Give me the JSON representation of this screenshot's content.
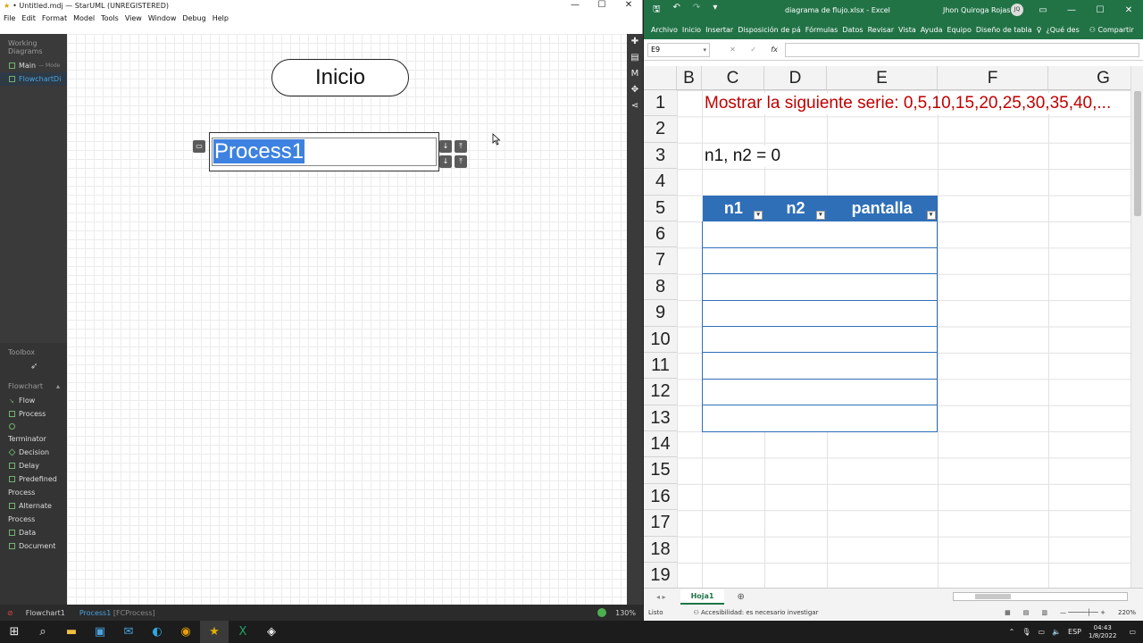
{
  "staruml": {
    "title": "• Untitled.mdj — StarUML (UNREGISTERED)",
    "menu": [
      "File",
      "Edit",
      "Format",
      "Model",
      "Tools",
      "View",
      "Window",
      "Debug",
      "Help"
    ],
    "working_diagrams_label": "Working Diagrams",
    "diagrams": [
      {
        "label": "Main",
        "sub": "— Mode"
      },
      {
        "label": "FlowchartDi",
        "sub": ""
      }
    ],
    "toolbox_label": "Toolbox",
    "flowchart_label": "Flowchart",
    "tools": [
      "Flow",
      "Process",
      "",
      "Terminator",
      "Decision",
      "Delay",
      "Predefined",
      "Process",
      "Alternate",
      "Process",
      "Data",
      "Document"
    ],
    "canvas": {
      "terminator_text": "Inicio",
      "process_text": "Process1"
    },
    "status": {
      "tab": "Flowchart1",
      "crumb": "Process1",
      "crumb_type": "[FCProcess]",
      "zoom": "130%"
    }
  },
  "excel": {
    "file_name": "diagrama de flujo.xlsx  -  Excel",
    "user": "Jhon Quiroga Rojas",
    "user_initials": "JQ",
    "ribbon_tabs": [
      "Archivo",
      "Inicio",
      "Insertar",
      "Disposición de pá",
      "Fórmulas",
      "Datos",
      "Revisar",
      "Vista",
      "Ayuda",
      "Equipo",
      "Diseño de tabla",
      "¿Qué des"
    ],
    "share_label": "Compartir",
    "name_box": "E9",
    "formula_value": "",
    "columns": [
      "B",
      "C",
      "D",
      "E",
      "F",
      "G"
    ],
    "rows": [
      "1",
      "2",
      "3",
      "4",
      "5",
      "6",
      "7",
      "8",
      "9",
      "10",
      "11",
      "12",
      "13",
      "14",
      "15",
      "16",
      "17",
      "18",
      "19"
    ],
    "cell_C1": "Mostrar la siguiente serie: 0,5,10,15,20,25,30,35,40,...",
    "cell_C3": "n1, n2 = 0",
    "table_headers": [
      "n1",
      "n2",
      "pantalla"
    ],
    "sheet_tab": "Hoja1",
    "status_ready": "Listo",
    "accessibility": "Accesibilidad: es necesario investigar",
    "zoom": "220%"
  },
  "taskbar": {
    "lang": "ESP",
    "time": "04:43",
    "date": "1/8/2022"
  }
}
